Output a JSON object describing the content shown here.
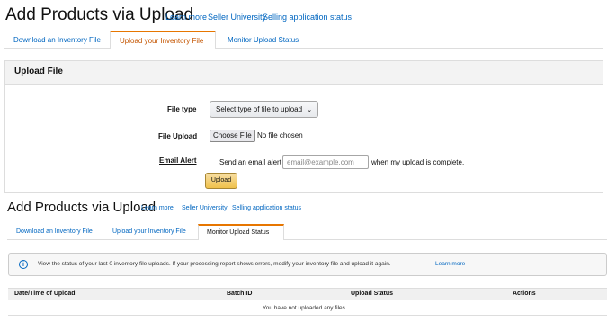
{
  "section1": {
    "title": "Add Products via Upload",
    "links": [
      "Learn more",
      "Seller University",
      "Selling application status"
    ],
    "tabs": [
      "Download an Inventory File",
      "Upload your Inventory File",
      "Monitor Upload Status"
    ],
    "panel_title": "Upload File",
    "form": {
      "file_type_label": "File type",
      "file_type_value": "Select type of file to upload",
      "file_upload_label": "File Upload",
      "choose_file": "Choose File",
      "no_file": "No file chosen",
      "email_alert_label": "Email Alert",
      "send_prefix": "Send an email alert",
      "email_placeholder": "email@example.com",
      "send_suffix": "when my upload is complete.",
      "upload_button": "Upload"
    }
  },
  "section2": {
    "title": "Add Products via Upload",
    "links": [
      "Learn more",
      "Seller University",
      "Selling application status"
    ],
    "tabs": [
      "Download an Inventory File",
      "Upload your Inventory File",
      "Monitor Upload Status"
    ],
    "info_text": "View the status of your last 0 inventory file uploads. If your processing report shows errors, modify your inventory file and upload it again.",
    "info_link": "Learn more",
    "table": {
      "headers": [
        "Date/Time of Upload",
        "Batch ID",
        "Upload Status",
        "Actions"
      ],
      "empty_message": "You have not uploaded any files."
    }
  },
  "colors": {
    "link": "#0066c0",
    "selected_tab": "#c45500",
    "tab_border": "#e77600",
    "button_yellow": "#f0c14b"
  }
}
